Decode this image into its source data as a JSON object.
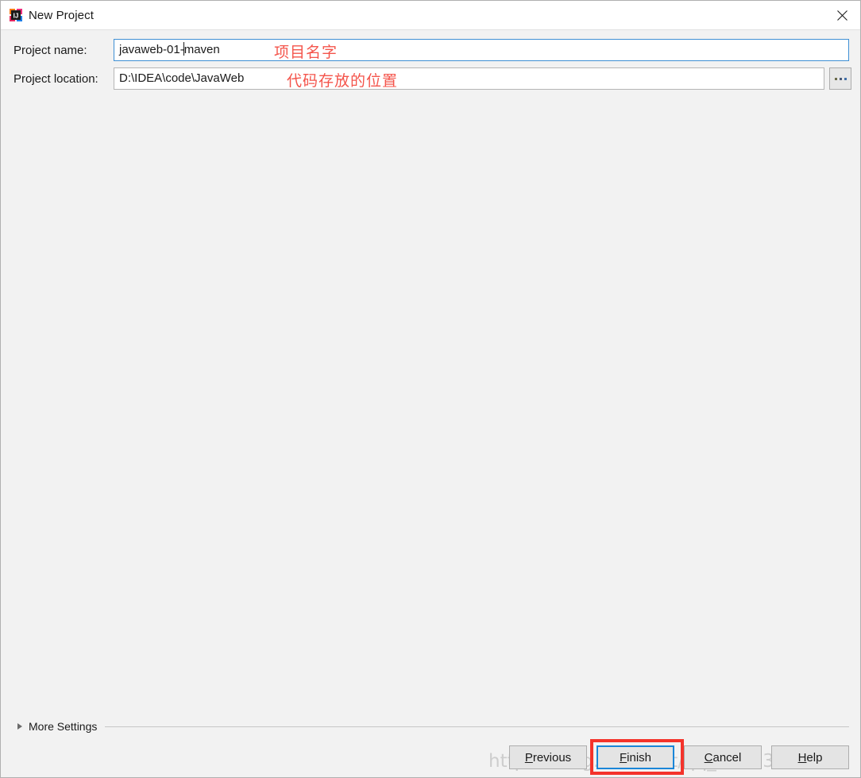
{
  "window": {
    "title": "New Project",
    "icon": "intellij-idea-icon",
    "close_icon": "close-icon"
  },
  "form": {
    "project_name": {
      "label": "Project name:",
      "value_before_caret": "javaweb-01-",
      "value_after_caret": "maven",
      "value": "javaweb-01-maven",
      "placeholder": "",
      "focused": true
    },
    "project_location": {
      "label": "Project location:",
      "value": "D:\\IDEA\\code\\JavaWeb",
      "placeholder": "",
      "browse_label": "...",
      "browse_icon": "ellipsis-icon"
    }
  },
  "annotations": {
    "project_name_note": "项目名字",
    "project_location_note": "代码存放的位置",
    "highlight_color": "#f4332b",
    "note_color": "#f4544b"
  },
  "more_settings": {
    "label": "More Settings",
    "expanded": false,
    "arrow_icon": "chevron-right-icon"
  },
  "buttons": [
    {
      "label": "Previous",
      "mnemonic": "P",
      "before": "",
      "after": "revious",
      "focused": false
    },
    {
      "label": "Finish",
      "mnemonic": "F",
      "before": "",
      "after": "inish",
      "focused": true
    },
    {
      "label": "Cancel",
      "mnemonic": "C",
      "before": "",
      "after": "ancel",
      "focused": false
    },
    {
      "label": "Help",
      "mnemonic": "H",
      "before": "",
      "after": "elp",
      "focused": false
    }
  ],
  "watermark": "https://blog.csdn.net/qq_44863882"
}
